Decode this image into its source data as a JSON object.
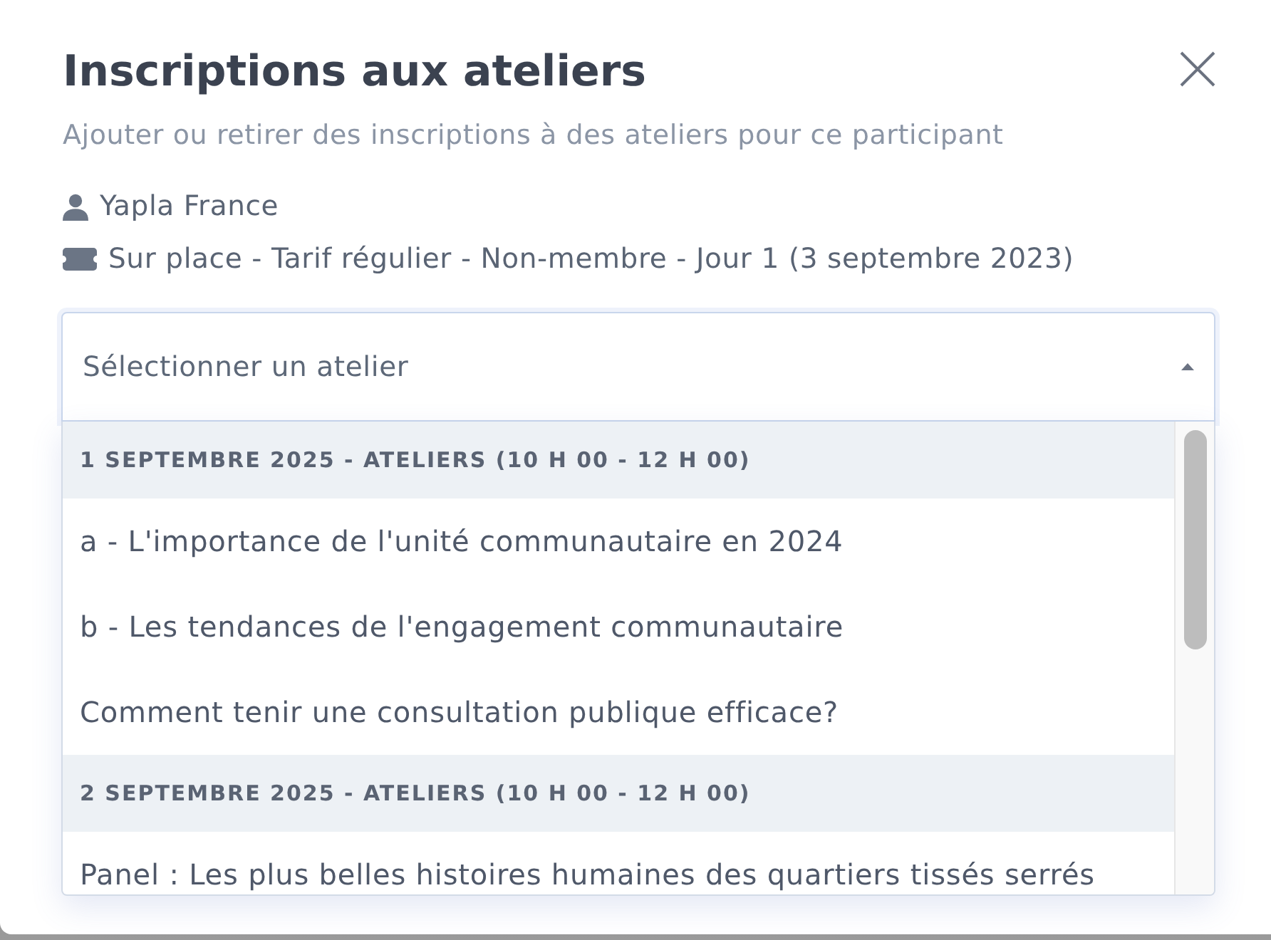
{
  "dialog": {
    "title": "Inscriptions aux ateliers",
    "subtitle": "Ajouter ou retirer des inscriptions à des ateliers pour ce participant"
  },
  "participant": {
    "name": "Yapla France",
    "ticket": "Sur place - Tarif régulier - Non-membre - Jour 1 (3 septembre 2023)"
  },
  "select": {
    "placeholder": "Sélectionner un atelier",
    "expanded": true
  },
  "options": [
    {
      "kind": "group",
      "label": "1 SEPTEMBRE 2025 - ATELIERS (10 H 00 - 12 H 00)"
    },
    {
      "kind": "option",
      "label": "a - L'importance de l'unité communautaire en 2024",
      "selected": false
    },
    {
      "kind": "option",
      "label": "b - Les tendances de l'engagement communautaire",
      "selected": false
    },
    {
      "kind": "option",
      "label": "Comment tenir une consultation publique efficace?",
      "selected": false
    },
    {
      "kind": "group",
      "label": "2 SEPTEMBRE 2025 - ATELIERS (10 H 00 - 12 H 00)"
    },
    {
      "kind": "option",
      "label": "Panel : Les plus belles histoires humaines des quartiers tissés serrés",
      "selected": false
    }
  ]
}
